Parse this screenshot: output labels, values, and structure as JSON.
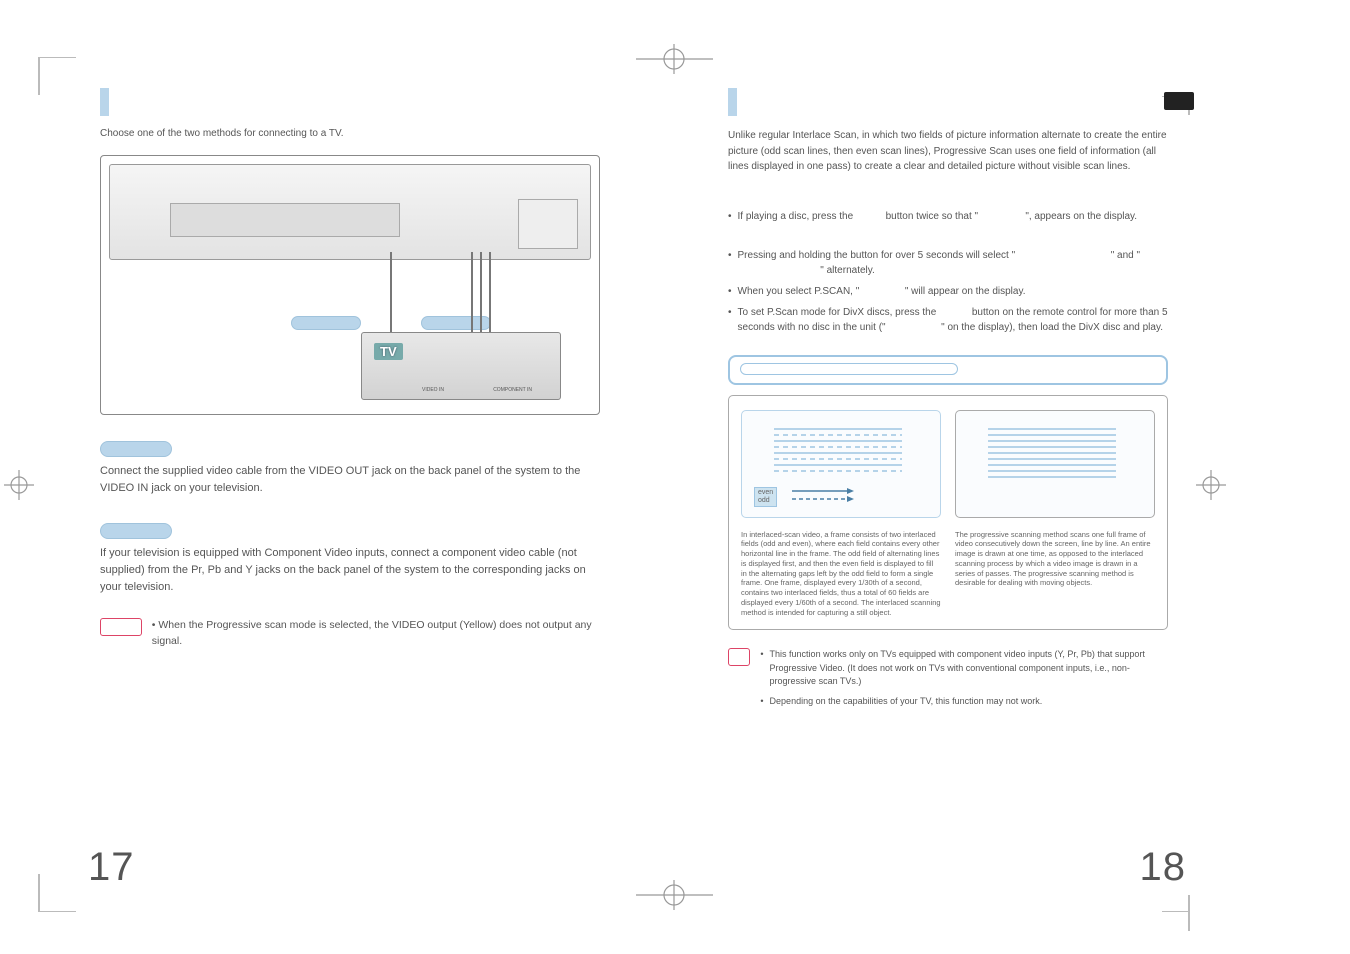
{
  "left": {
    "intro": "Choose one of the two methods for connecting to a TV.",
    "tv_label": "TV",
    "tv_video": "VIDEO IN",
    "tv_component": "COMPONENT IN",
    "method1": {
      "text": "Connect the supplied video cable from the VIDEO OUT jack on the back panel of the system to the VIDEO IN jack on your television."
    },
    "method2": {
      "text": "If your television is equipped with Component Video inputs, connect a component video cable (not supplied) from the Pr, Pb and Y jacks on the back panel of the system to the corresponding jacks on your television."
    },
    "caution": "When the Progressive scan mode is selected, the VIDEO output (Yellow) does not output any signal."
  },
  "right": {
    "intro": "Unlike regular Interlace Scan, in which two fields of picture information alternate to create the entire picture (odd scan lines, then even scan lines), Progressive Scan uses one field of information (all lines displayed in one pass) to create a clear and detailed picture without visible scan lines.",
    "b1a": "If playing a disc, press the ",
    "b1b": " button twice so that \"",
    "b1c": "\", appears on the display.",
    "b2a": "Pressing and holding the button for over 5 seconds will select \"",
    "b2b": "\" and \"",
    "b2c": "\" alternately.",
    "b3a": "When you select P.SCAN, \"",
    "b3b": "\" will appear on the display.",
    "b4a": "To set P.Scan mode for DivX discs, press the ",
    "b4b": " button on the remote control for more than 5 seconds with no disc in the unit (\"",
    "b4c": "\" on the display), then load the DivX disc and play.",
    "interlaced_lbl_even": "even",
    "interlaced_lbl_odd": "odd",
    "interlaced_text": "In interlaced-scan video, a frame consists of two interlaced fields (odd and even), where each field contains every other horizontal line in the frame. The odd field of alternating lines is displayed first, and then the even field is displayed to fill in the alternating gaps left by the odd field to form a single frame. One frame, displayed every 1/30th of a second, contains two interlaced fields, thus a total of 60 fields are displayed every 1/60th of a second. The interlaced scanning method is intended for capturing a still object.",
    "progressive_text": "The progressive scanning method scans one full frame of video consecutively down the screen, line by line. An entire image is drawn at one time, as opposed to the interlaced scanning process by which a video image is drawn in a series of passes. The progressive scanning method is desirable for dealing with moving objects.",
    "note1": "This function works only on TVs equipped with component video inputs (Y, Pr, Pb) that support Progressive Video. (It does not work on TVs with conventional component inputs, i.e., non-progressive scan TVs.)",
    "note2": "Depending on the capabilities of your TV, this function may not work."
  },
  "page_left": "17",
  "page_right": "18"
}
